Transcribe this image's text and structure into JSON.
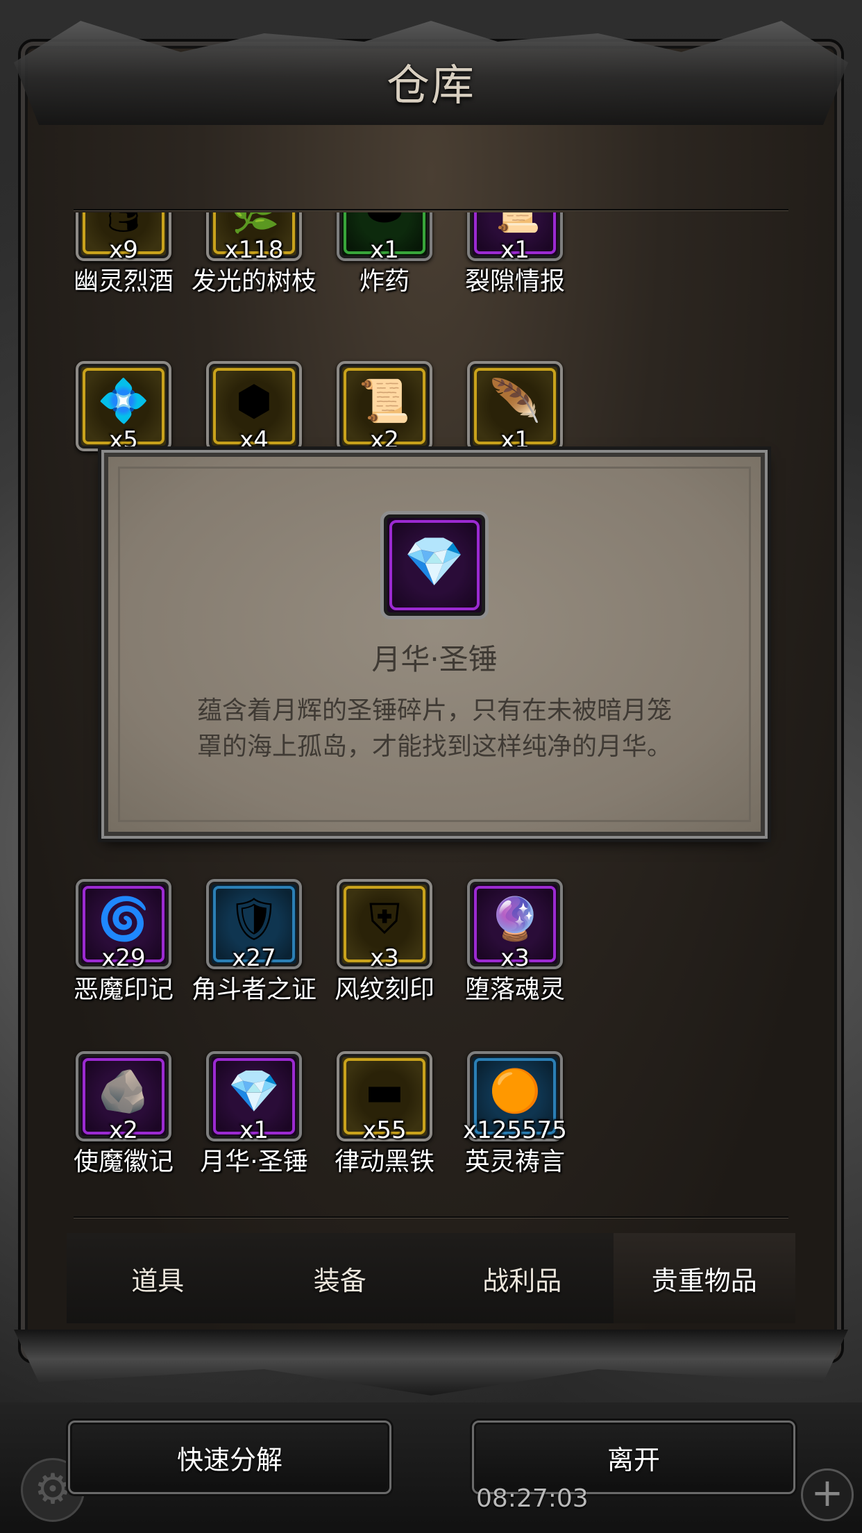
{
  "title": "仓库",
  "items": [
    {
      "icon": "barrel-icon",
      "glyph": "🛢",
      "count": "x9",
      "name": "幽灵烈酒",
      "rarity": "gold"
    },
    {
      "icon": "glowing-branch-icon",
      "glyph": "🌿",
      "count": "x118",
      "name": "发光的树枝",
      "rarity": "gold"
    },
    {
      "icon": "explosive-icon",
      "glyph": "⬬",
      "count": "x1",
      "name": "炸药",
      "rarity": "green"
    },
    {
      "icon": "scroll-icon",
      "glyph": "📜",
      "count": "x1",
      "name": "裂隙情报",
      "rarity": "purple"
    },
    {
      "icon": "crystal-icon",
      "glyph": "💠",
      "count": "x5",
      "name": "",
      "rarity": "gold"
    },
    {
      "icon": "cube-icon",
      "glyph": "⬢",
      "count": "x4",
      "name": "",
      "rarity": "gold"
    },
    {
      "icon": "parchment-icon",
      "glyph": "📜",
      "count": "x2",
      "name": "",
      "rarity": "gold"
    },
    {
      "icon": "feather-icon",
      "glyph": "🪶",
      "count": "x1",
      "name": "",
      "rarity": "gold"
    },
    {
      "icon": "demon-mark-icon",
      "glyph": "🌀",
      "count": "x29",
      "name": "恶魔印记",
      "rarity": "purple"
    },
    {
      "icon": "gladiator-badge-icon",
      "glyph": "🛡",
      "count": "x27",
      "name": "角斗者之证",
      "rarity": "blue"
    },
    {
      "icon": "wind-seal-icon",
      "glyph": "⛨",
      "count": "x3",
      "name": "风纹刻印",
      "rarity": "gold"
    },
    {
      "icon": "fallen-soul-icon",
      "glyph": "🔮",
      "count": "x3",
      "name": "堕落魂灵",
      "rarity": "purple"
    },
    {
      "icon": "envoy-emblem-icon",
      "glyph": "🪨",
      "count": "x2",
      "name": "使魔徽记",
      "rarity": "purple"
    },
    {
      "icon": "moon-hammer-shard-icon",
      "glyph": "💎",
      "count": "x1",
      "name": "月华·圣锤",
      "rarity": "purple"
    },
    {
      "icon": "black-iron-icon",
      "glyph": "▬",
      "count": "x55",
      "name": "律动黑铁",
      "rarity": "gold"
    },
    {
      "icon": "hero-prayer-icon",
      "glyph": "🟠",
      "count": "x125575",
      "name": "英灵祷言",
      "rarity": "blue"
    }
  ],
  "tooltip": {
    "icon": "moon-hammer-shard-icon",
    "glyph": "💎",
    "title": "月华·圣锤",
    "desc_line1": "蕴含着月辉的圣锤碎片，只有在未被暗月笼",
    "desc_line2": "罩的海上孤岛，才能找到这样纯净的月华。"
  },
  "tabs": [
    "道具",
    "装备",
    "战利品",
    "贵重物品"
  ],
  "active_tab": "贵重物品",
  "buttons": {
    "decompose": "快速分解",
    "leave": "离开"
  },
  "status": {
    "clock": "08:27:03"
  },
  "colors": {
    "gold": "#c9a21c",
    "purple": "#9b2ad1",
    "blue": "#2b7fb5",
    "green": "#38a53a"
  }
}
